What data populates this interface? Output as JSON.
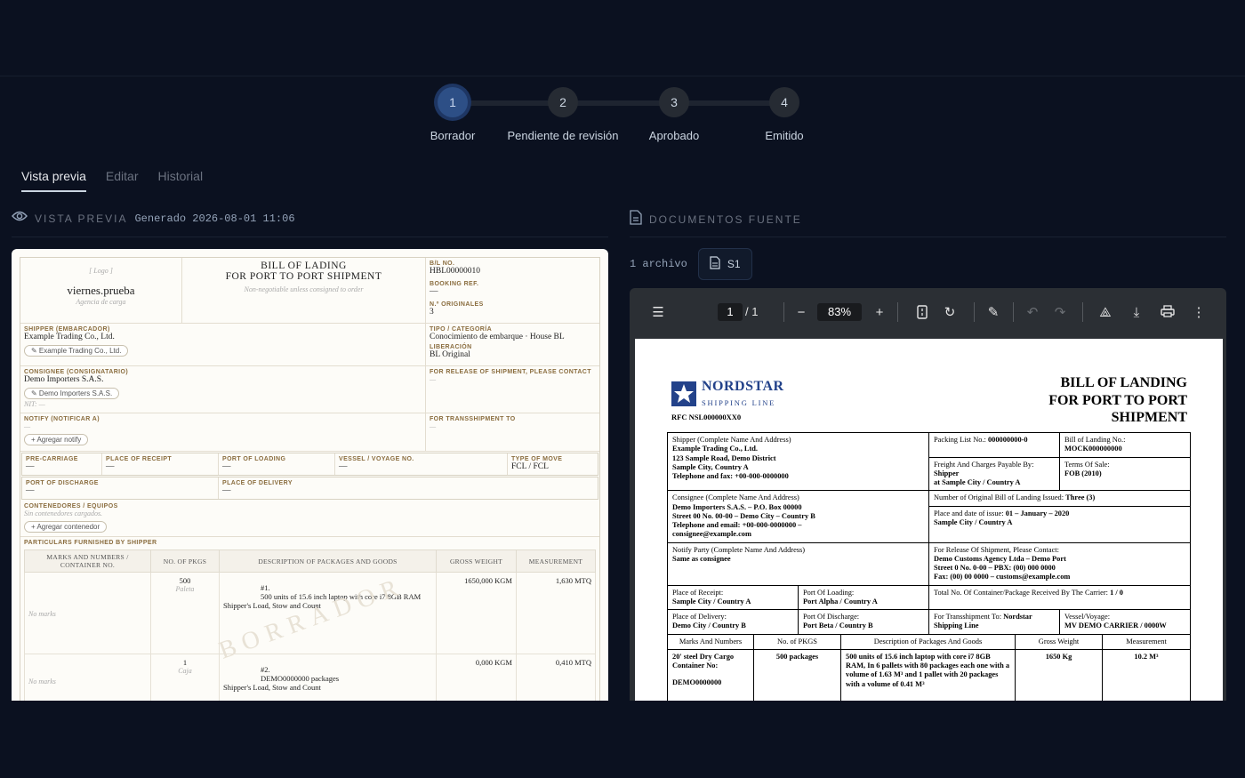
{
  "steps": [
    {
      "num": "1",
      "label": "Borrador"
    },
    {
      "num": "2",
      "label": "Pendiente de revisión"
    },
    {
      "num": "3",
      "label": "Aprobado"
    },
    {
      "num": "4",
      "label": "Emitido"
    }
  ],
  "tabs": [
    "Vista previa",
    "Editar",
    "Historial"
  ],
  "preview": {
    "heading": "VISTA PREVIA",
    "generated": "Generado 2026-08-01 11:06"
  },
  "sources": {
    "heading": "DOCUMENTOS FUENTE",
    "count": "1 archivo",
    "chip": "S1"
  },
  "draft": {
    "logo": "[ Logo ]",
    "company": "viernes.prueba",
    "agency": "Agencia de carga",
    "title1": "BILL OF LADING",
    "title2": "FOR PORT TO PORT SHIPMENT",
    "negotiable": "Non-negotiable unless consigned to order",
    "bl_no_label": "B/L NO.",
    "bl_no": "HBL00000010",
    "booking_label": "BOOKING REF.",
    "booking": "—",
    "originals_label": "N.º ORIGINALES",
    "originals": "3",
    "shipper_label": "SHIPPER (EMBARCADOR)",
    "shipper": "Example Trading Co., Ltd.",
    "shipper_pill": "✎ Example Trading Co., Ltd.",
    "tipo_label": "TIPO / CATEGORÍA",
    "tipo": "Conocimiento de embarque · House BL",
    "lib_label": "LIBERACIÓN",
    "lib": "BL Original",
    "consignee_label": "CONSIGNEE (CONSIGNATARIO)",
    "consignee": "Demo Importers S.A.S.",
    "consignee_pill": "✎ Demo Importers S.A.S.",
    "nit": "NIT: —",
    "release_label": "FOR RELEASE OF SHIPMENT, PLEASE CONTACT",
    "release": "—",
    "notify_label": "NOTIFY (NOTIFICAR A)",
    "notify": "—",
    "notify_btn": "+ Agregar notify",
    "transship_label": "FOR TRANSSHIPMENT TO",
    "transship": "—",
    "precarriage_label": "PRE-CARRIAGE",
    "precarriage": "—",
    "receipt_label": "PLACE OF RECEIPT",
    "receipt": "—",
    "loading_label": "PORT OF LOADING",
    "loading": "—",
    "vessel_label": "VESSEL / VOYAGE NO.",
    "vessel": "—",
    "move_label": "TYPE OF MOVE",
    "move": "FCL / FCL",
    "discharge_label": "PORT OF DISCHARGE",
    "discharge": "—",
    "delivery_label": "PLACE OF DELIVERY",
    "delivery": "—",
    "containers_label": "CONTENEDORES / EQUIPOS",
    "containers_empty": "Sin contenedores cargados.",
    "containers_btn": "+ Agregar contenedor",
    "particulars_label": "PARTICULARS FURNISHED BY SHIPPER",
    "cols": [
      "MARKS AND NUMBERS / CONTAINER NO.",
      "NO. OF PKGS",
      "DESCRIPTION OF PACKAGES AND GOODS",
      "GROSS WEIGHT",
      "MEASUREMENT"
    ],
    "rows": [
      {
        "marks": "No marks",
        "pkgs": "500",
        "unit": "Paleta",
        "num": "#1.",
        "desc": "500 units of 15.6 inch laptop with core i7 8GB RAM",
        "slc": "Shipper's Load, Stow and Count",
        "gw": "1650,000 KGM",
        "meas": "1,630 MTQ"
      },
      {
        "marks": "No marks",
        "pkgs": "1",
        "unit": "Caja",
        "num": "#2.",
        "desc": "DEMO0000000 packages",
        "slc": "Shipper's Load, Stow and Count",
        "gw": "0,000 KGM",
        "meas": "0,410 MTQ"
      }
    ],
    "watermark": "BORRADOR"
  },
  "viewer": {
    "page": "1",
    "total": "/  1",
    "zoom": "83%"
  },
  "pdf": {
    "brand": "NORDSTAR",
    "brand_sub": "SHIPPING LINE",
    "rfc": "RFC NSL000000XX0",
    "title1": "BILL OF LANDING",
    "title2": "FOR PORT TO PORT",
    "title3": "SHIPMENT",
    "shipper_label": "Shipper (Complete Name And Address)",
    "shipper": "Example Trading Co., Ltd.",
    "shipper_addr": "123 Sample Road, Demo District",
    "shipper_city": "Sample City, Country A",
    "shipper_tel": "Telephone and fax: +00-000-0000000",
    "packing_label": "Packing List No.: ",
    "packing": "000000000-0",
    "blno_label": "Bill of Landing No.:",
    "blno": "MOCK000000000",
    "freight_label": "Freight And Charges Payable By:",
    "freight": "Shipper",
    "freight_at": "at Sample City / Country A",
    "terms_label": "Terms Of Sale:",
    "terms": "FOB (2010)",
    "consignee_label": "Consignee (Complete Name And Address)",
    "consignee": "Demo Importers S.A.S. – P.O. Box 00000",
    "consignee_addr": "Street 00 No. 00-00 – Demo City – Country B",
    "consignee_tel": "Telephone and email: +00-000-0000000 –",
    "consignee_mail": "consignee@example.com",
    "originals_label": "Number of Original Bill of Landing Issued: ",
    "originals": "Three (3)",
    "issue_label": "Place and date of issue: ",
    "issue_date": "01 – January – 2020",
    "issue_place": "Sample City / Country A",
    "notify_label": "Notify Party (Complete Name And Address)",
    "notify": "Same as consignee",
    "release_label": "For Release Of Shipment, Please Contact:",
    "release1": "Demo Customs Agency Ltda – Demo Port",
    "release2": "Street 0 No. 0-00 – PBX: (00) 000 0000",
    "release3": "Fax: (00) 00 0000 – customs@example.com",
    "receipt_label": "Place of Receipt:",
    "receipt": "Sample City / Country A",
    "loading_label": "Port Of Loading:",
    "loading": "Port Alpha / Country A",
    "total_label": "Total No. Of Container/Package Received By The Carrier: ",
    "total": "1 / 0",
    "delivery_label": "Place of Delivery:",
    "delivery": "Demo City / Country B",
    "discharge_label": "Port Of Discharge:",
    "discharge": "Port Beta / Country B",
    "transship_label": "For Transshipment To: ",
    "transship": "Nordstar",
    "transship2": "Shipping Line",
    "vessel_label": "Vessel/Voyage:",
    "vessel": "MV DEMO CARRIER / 0000W",
    "cols": [
      "Marks And Numbers",
      "No. of PKGS",
      "Description of Packages And Goods",
      "Gross Weight",
      "Measurement"
    ],
    "marks1": "20' steel Dry Cargo",
    "marks2": "Container No:",
    "marks3": "DEMO0000000",
    "pkgs": "500 packages",
    "desc": "500 units of 15.6 inch laptop with core i7 8GB RAM, In 6 pallets with 80 packages each one with a volume of 1.63 M³ and 1 pallet with 20 packages with a volume of 0.41 M³",
    "gw": "1650 Kg",
    "meas": "10.2 M³"
  }
}
